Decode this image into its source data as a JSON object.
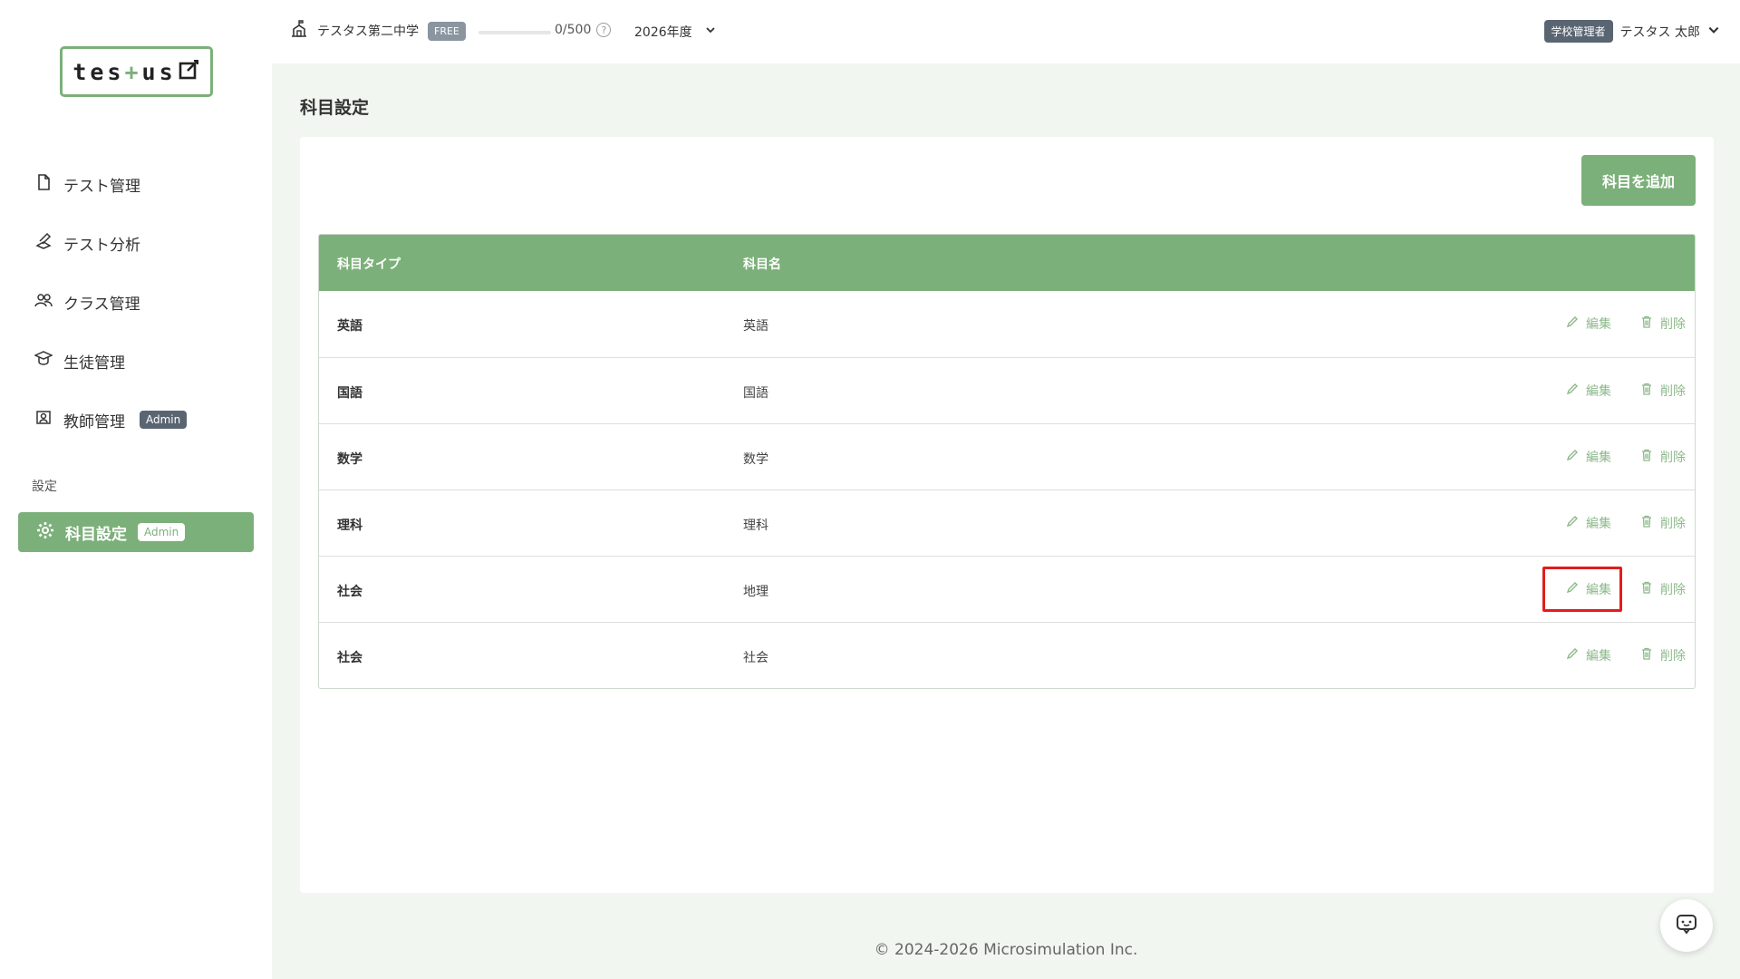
{
  "header": {
    "school_name": "テスタス第二中学",
    "plan_badge": "FREE",
    "usage": {
      "current": 0,
      "max": 500,
      "text": "0/500"
    },
    "year": "2026年度",
    "role_badge": "学校管理者",
    "user_name": "テスタス 太郎"
  },
  "sidebar": {
    "logo": {
      "prefix": "tes",
      "plus": "+",
      "suffix": "us"
    },
    "items": [
      {
        "label": "テスト管理",
        "icon": "document-icon"
      },
      {
        "label": "テスト分析",
        "icon": "analysis-icon"
      },
      {
        "label": "クラス管理",
        "icon": "class-icon"
      },
      {
        "label": "生徒管理",
        "icon": "student-icon"
      },
      {
        "label": "教師管理",
        "icon": "teacher-icon",
        "badge": "Admin"
      }
    ],
    "section_label": "設定",
    "active_item": {
      "label": "科目設定",
      "icon": "gear-icon",
      "badge": "Admin"
    }
  },
  "main": {
    "page_title": "科目設定",
    "add_button_label": "科目を追加",
    "table": {
      "headers": [
        "科目タイプ",
        "科目名"
      ],
      "edit_label": "編集",
      "delete_label": "削除",
      "rows": [
        {
          "type": "英語",
          "name": "英語"
        },
        {
          "type": "国語",
          "name": "国語"
        },
        {
          "type": "数学",
          "name": "数学"
        },
        {
          "type": "理科",
          "name": "理科"
        },
        {
          "type": "社会",
          "name": "地理"
        },
        {
          "type": "社会",
          "name": "社会"
        }
      ]
    }
  },
  "footer": {
    "copyright": "© 2024-2026 Microsimulation Inc."
  },
  "colors": {
    "accent": "#7cb07a",
    "highlight": "#e11d1d",
    "admin_badge": "#5a6572"
  }
}
